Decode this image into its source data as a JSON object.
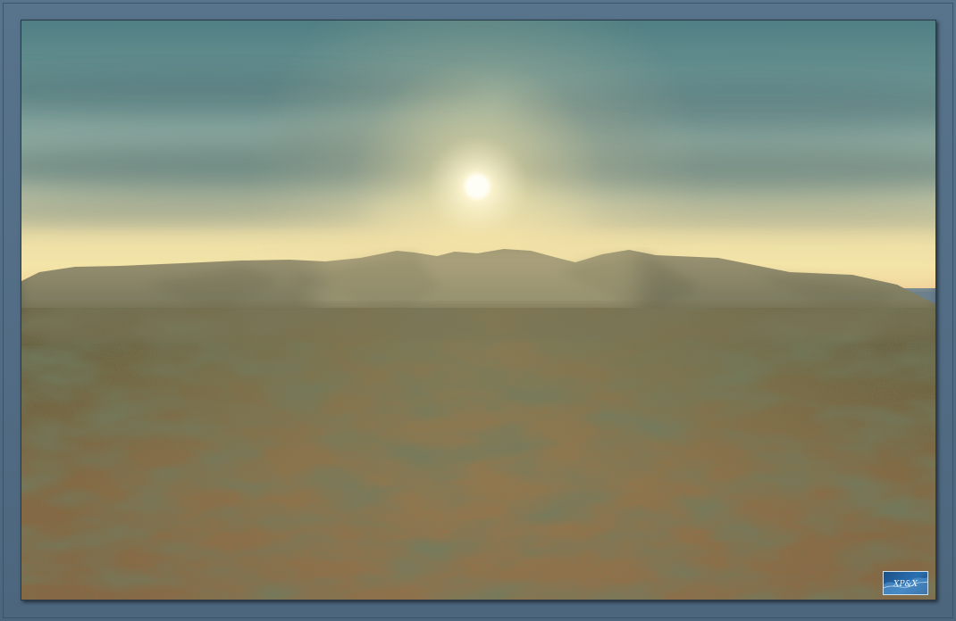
{
  "scene": {
    "subject": "landscape-render",
    "colors": {
      "frame": "#4f6a82",
      "sky_top": "#5f8a8c",
      "sky_mid": "#9cb2a6",
      "horizon_glow": "#f4e3a2",
      "sun": "#fffbe6",
      "mountains": "#6a6a52",
      "ground_near": "#8a6440",
      "ground_far": "#5f5a3c"
    }
  },
  "logo": {
    "icon": "xpsx-logo-icon",
    "text": "XP&X"
  }
}
